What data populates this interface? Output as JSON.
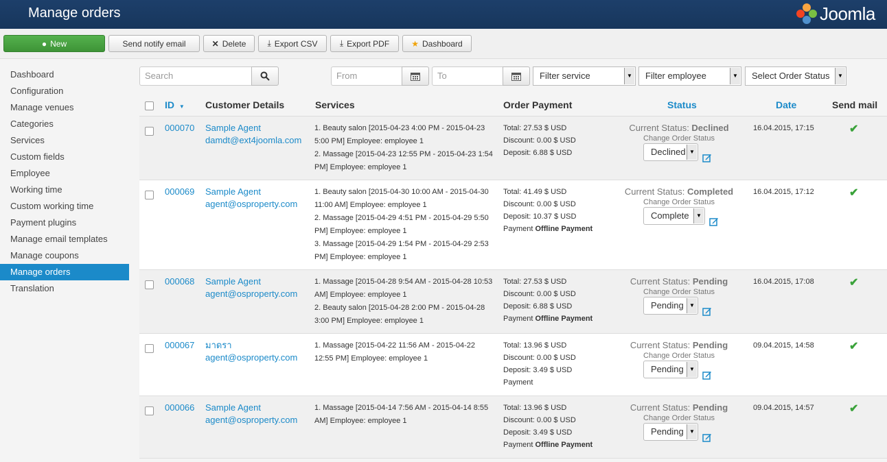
{
  "header": {
    "title": "Manage orders",
    "logo_text": "Joomla"
  },
  "toolbar": {
    "new_label": "New",
    "notify_label": "Send notify email",
    "delete_label": "Delete",
    "csv_label": "Export CSV",
    "pdf_label": "Export PDF",
    "dashboard_label": "Dashboard"
  },
  "sidebar": {
    "items": [
      {
        "label": "Dashboard"
      },
      {
        "label": "Configuration"
      },
      {
        "label": "Manage venues"
      },
      {
        "label": "Categories"
      },
      {
        "label": "Services"
      },
      {
        "label": "Custom fields"
      },
      {
        "label": "Employee"
      },
      {
        "label": "Working time"
      },
      {
        "label": "Custom working time"
      },
      {
        "label": "Payment plugins"
      },
      {
        "label": "Manage email templates"
      },
      {
        "label": "Manage coupons"
      },
      {
        "label": "Manage orders"
      },
      {
        "label": "Translation"
      }
    ]
  },
  "filters": {
    "search_placeholder": "Search",
    "from_placeholder": "From",
    "to_placeholder": "To",
    "service": "Filter service",
    "employee": "Filter employee",
    "status": "Select Order Status"
  },
  "table": {
    "headers": {
      "id": "ID",
      "customer": "Customer Details",
      "services": "Services",
      "payment": "Order Payment",
      "status": "Status",
      "date": "Date",
      "sendmail": "Send mail"
    },
    "change_label": "Change Order Status",
    "rows": [
      {
        "id": "000070",
        "name": "Sample Agent",
        "email": "damdt@ext4joomla.com",
        "services": "1. Beauty salon [2015-04-23 4:00 PM - 2015-04-23 5:00 PM] Employee: employee 1\n2. Massage [2015-04-23 12:55 PM - 2015-04-23 1:54 PM] Employee: employee 1",
        "total": "Total: 27.53 $ USD",
        "discount": "Discount: 0.00 $ USD",
        "deposit": "Deposit: 6.88 $ USD",
        "payment_prefix": "",
        "payment_method": "",
        "status_prefix": "Current Status: ",
        "status": "Declined",
        "select": "Declined",
        "date": "16.04.2015, 17:15",
        "sendmail": "✔"
      },
      {
        "id": "000069",
        "name": "Sample Agent",
        "email": "agent@osproperty.com",
        "services": "1. Beauty salon [2015-04-30 10:00 AM - 2015-04-30 11:00 AM] Employee: employee 1\n2. Massage [2015-04-29 4:51 PM - 2015-04-29 5:50 PM] Employee: employee 1\n3. Massage [2015-04-29 1:54 PM - 2015-04-29 2:53 PM] Employee: employee 1",
        "total": "Total: 41.49 $ USD",
        "discount": "Discount: 0.00 $ USD",
        "deposit": "Deposit: 10.37 $ USD",
        "payment_prefix": "Payment ",
        "payment_method": "Offline Payment",
        "status_prefix": "Current Status: ",
        "status": "Completed",
        "select": "Complete",
        "date": "16.04.2015, 17:12",
        "sendmail": "✔"
      },
      {
        "id": "000068",
        "name": "Sample Agent",
        "email": "agent@osproperty.com",
        "services": "1. Massage [2015-04-28 9:54 AM - 2015-04-28 10:53 AM] Employee: employee 1\n2. Beauty salon [2015-04-28 2:00 PM - 2015-04-28 3:00 PM] Employee: employee 1",
        "total": "Total: 27.53 $ USD",
        "discount": "Discount: 0.00 $ USD",
        "deposit": "Deposit: 6.88 $ USD",
        "payment_prefix": "Payment ",
        "payment_method": "Offline Payment",
        "status_prefix": "Current Status: ",
        "status": "Pending",
        "select": "Pending",
        "date": "16.04.2015, 17:08",
        "sendmail": "✔"
      },
      {
        "id": "000067",
        "name": "มาดรา",
        "email": "agent@osproperty.com",
        "services": "1. Massage [2015-04-22 11:56 AM - 2015-04-22 12:55 PM] Employee: employee 1",
        "total": "Total: 13.96 $ USD",
        "discount": "Discount: 0.00 $ USD",
        "deposit": "Deposit: 3.49 $ USD",
        "payment_prefix": "Payment",
        "payment_method": "",
        "status_prefix": "Current Status: ",
        "status": "Pending",
        "select": "Pending",
        "date": "09.04.2015, 14:58",
        "sendmail": "✔"
      },
      {
        "id": "000066",
        "name": "Sample Agent",
        "email": "agent@osproperty.com",
        "services": "1. Massage [2015-04-14 7:56 AM - 2015-04-14 8:55 AM] Employee: employee 1",
        "total": "Total: 13.96 $ USD",
        "discount": "Discount: 0.00 $ USD",
        "deposit": "Deposit: 3.49 $ USD",
        "payment_prefix": "Payment ",
        "payment_method": "Offline Payment",
        "status_prefix": "Current Status: ",
        "status": "Pending",
        "select": "Pending",
        "date": "09.04.2015, 14:57",
        "sendmail": "✔"
      }
    ]
  }
}
